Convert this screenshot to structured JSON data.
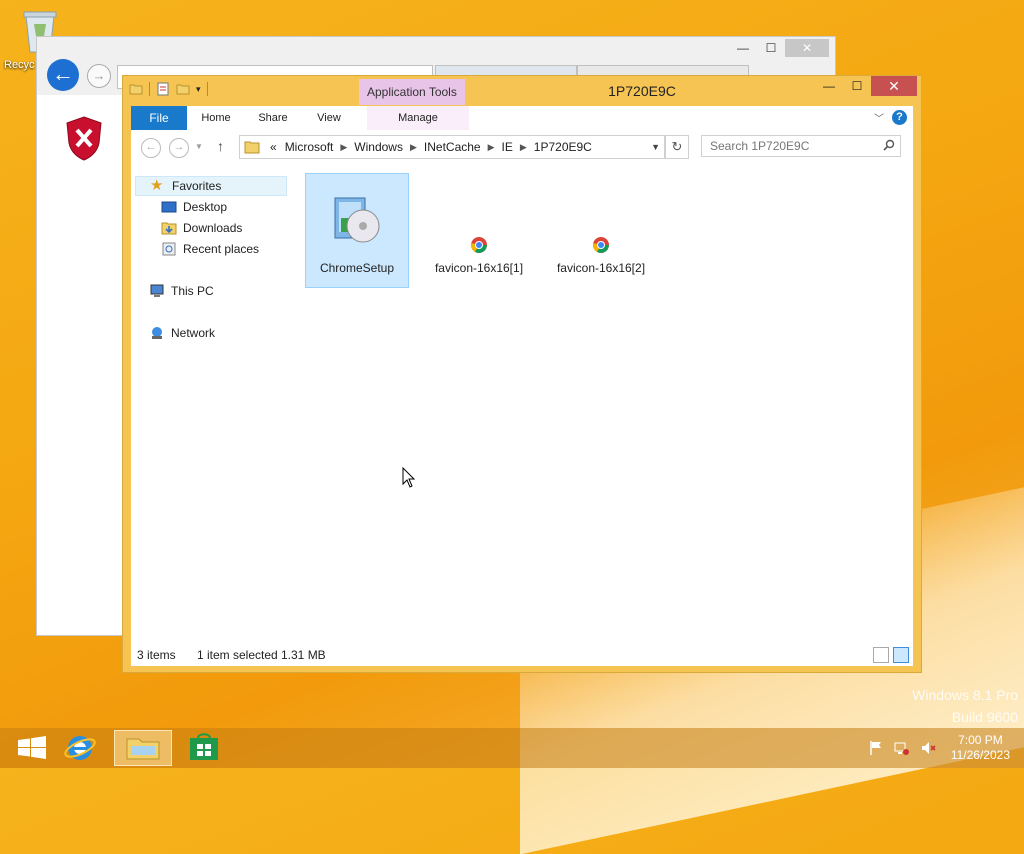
{
  "desktop": {
    "recycle_bin_label": "Recyc"
  },
  "explorer": {
    "title": "1P720E9C",
    "contextual_tab": "Application Tools",
    "ribbon_tabs": {
      "file": "File",
      "home": "Home",
      "share": "Share",
      "view": "View",
      "manage": "Manage"
    },
    "breadcrumb": {
      "overflow": "«",
      "segments": [
        "Microsoft",
        "Windows",
        "INetCache",
        "IE",
        "1P720E9C"
      ]
    },
    "search_placeholder": "Search 1P720E9C",
    "nav": {
      "favorites": "Favorites",
      "desktop": "Desktop",
      "downloads": "Downloads",
      "recent": "Recent places",
      "this_pc": "This PC",
      "network": "Network"
    },
    "files": [
      {
        "name": "ChromeSetup",
        "icon": "installer-disc-icon",
        "selected": true
      },
      {
        "name": "favicon-16x16[1]",
        "icon": "chrome-icon",
        "selected": false
      },
      {
        "name": "favicon-16x16[2]",
        "icon": "chrome-icon",
        "selected": false
      }
    ],
    "status": {
      "count": "3 items",
      "selection": "1 item selected",
      "size": "1.31 MB"
    }
  },
  "watermark": {
    "line1": "Windows 8.1 Pro",
    "line2": "Build 9600"
  },
  "taskbar": {
    "time": "7:00 PM",
    "date": "11/26/2023"
  },
  "colors": {
    "accent": "#1979ca",
    "frame": "#f5c453",
    "contextual": "#e8c4e8",
    "close": "#c75050"
  }
}
